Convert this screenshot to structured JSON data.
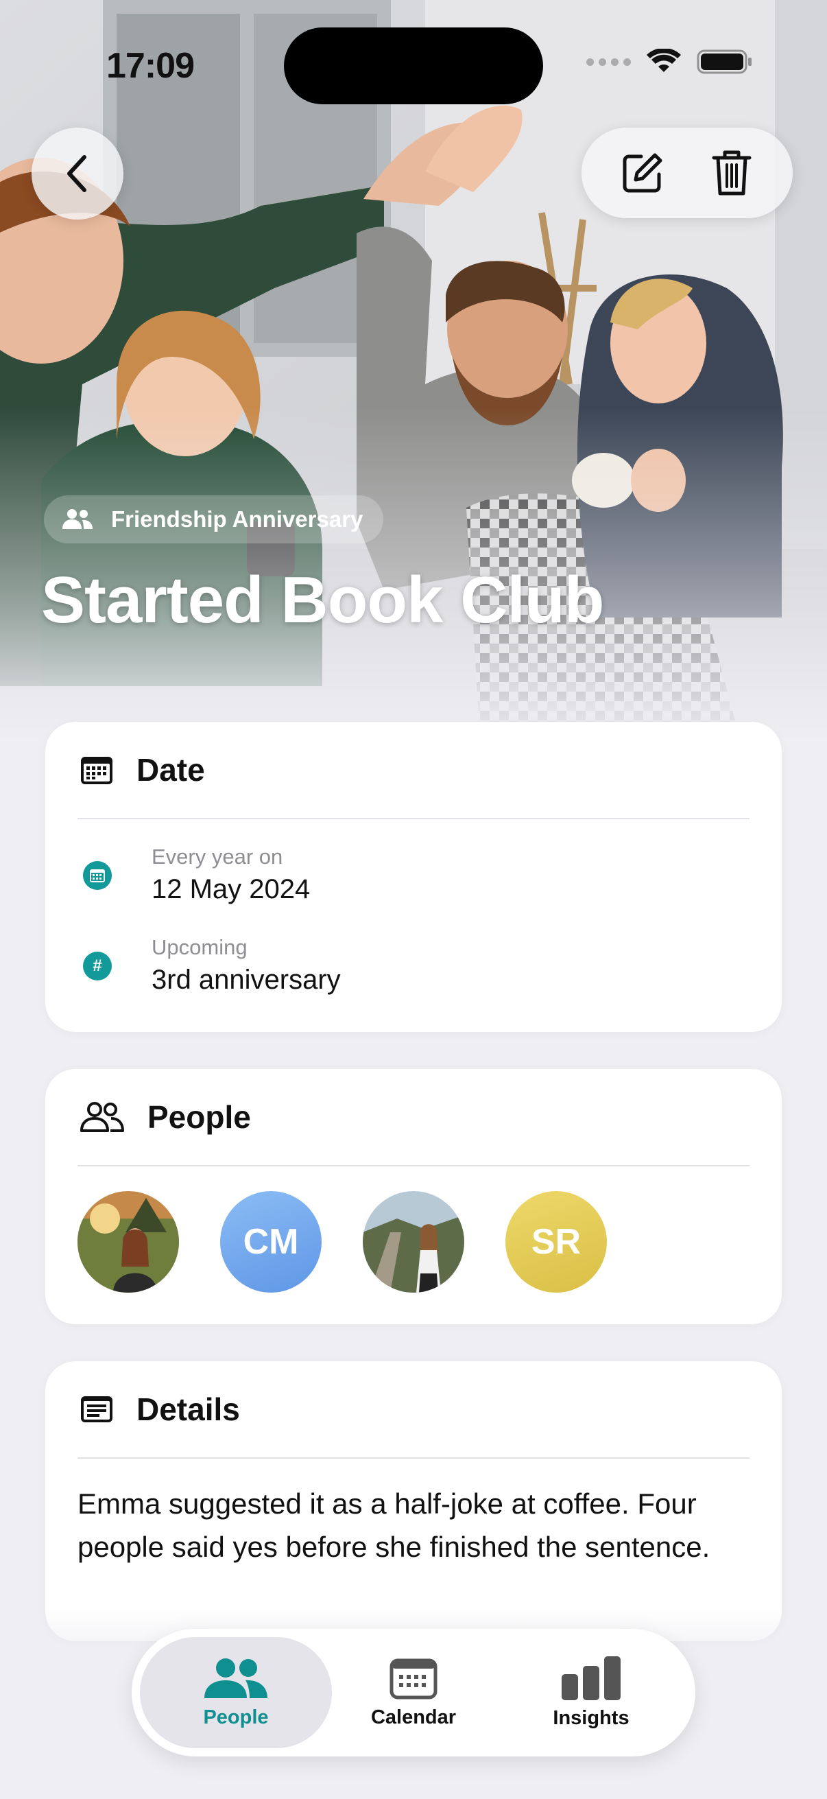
{
  "status_bar": {
    "time": "17:09"
  },
  "hero": {
    "category": "Friendship Anniversary",
    "title": "Started Book Club"
  },
  "date_card": {
    "title": "Date",
    "rows": [
      {
        "label": "Every year on",
        "value": "12 May 2024",
        "icon": "calendar-icon",
        "glyph": ""
      },
      {
        "label": "Upcoming",
        "value": "3rd anniversary",
        "icon": "hash-icon",
        "glyph": "#"
      }
    ]
  },
  "people_card": {
    "title": "People",
    "people": [
      {
        "type": "photo",
        "initials": "",
        "color": "#6f7d3d"
      },
      {
        "type": "initials",
        "initials": "CM",
        "color": "#7aaef0"
      },
      {
        "type": "photo",
        "initials": "",
        "color": "#8a8f92"
      },
      {
        "type": "initials",
        "initials": "SR",
        "color": "#e6cf5b"
      }
    ]
  },
  "details_card": {
    "title": "Details",
    "text": "Emma suggested it as a half-joke at coffee. Four people said yes before she finished the sentence."
  },
  "tab_bar": {
    "tabs": [
      {
        "label": "People",
        "icon": "people-icon",
        "active": true
      },
      {
        "label": "Calendar",
        "icon": "calendar-icon",
        "active": false
      },
      {
        "label": "Insights",
        "icon": "insights-icon",
        "active": false
      }
    ]
  },
  "colors": {
    "accent": "#12999a",
    "background": "#eeeef3",
    "card": "#ffffff"
  }
}
